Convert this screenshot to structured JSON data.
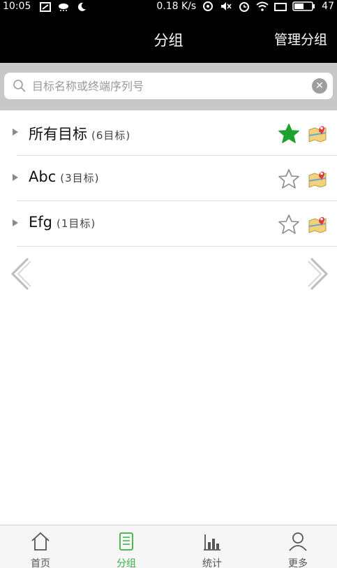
{
  "status_bar": {
    "time": "10:05",
    "network_speed": "0.18 K/s",
    "battery": "47"
  },
  "header": {
    "title": "分组",
    "manage_label": "管理分组"
  },
  "search": {
    "placeholder": "目标名称或终端序列号"
  },
  "groups": [
    {
      "name": "所有目标",
      "count": "(6目标)",
      "starred": true
    },
    {
      "name": "Abc",
      "count": "(3目标)",
      "starred": false
    },
    {
      "name": "Efg",
      "count": "(1目标)",
      "starred": false
    }
  ],
  "colors": {
    "accent": "#3cb043",
    "star_active": "#1fa12f",
    "header_bg": "#000000",
    "search_bg": "#c8c8c8"
  },
  "tabbar": {
    "items": [
      {
        "label": "首页",
        "icon": "home-icon",
        "active": false
      },
      {
        "label": "分组",
        "icon": "group-icon",
        "active": true
      },
      {
        "label": "统计",
        "icon": "stats-icon",
        "active": false
      },
      {
        "label": "更多",
        "icon": "person-icon",
        "active": false
      }
    ]
  }
}
